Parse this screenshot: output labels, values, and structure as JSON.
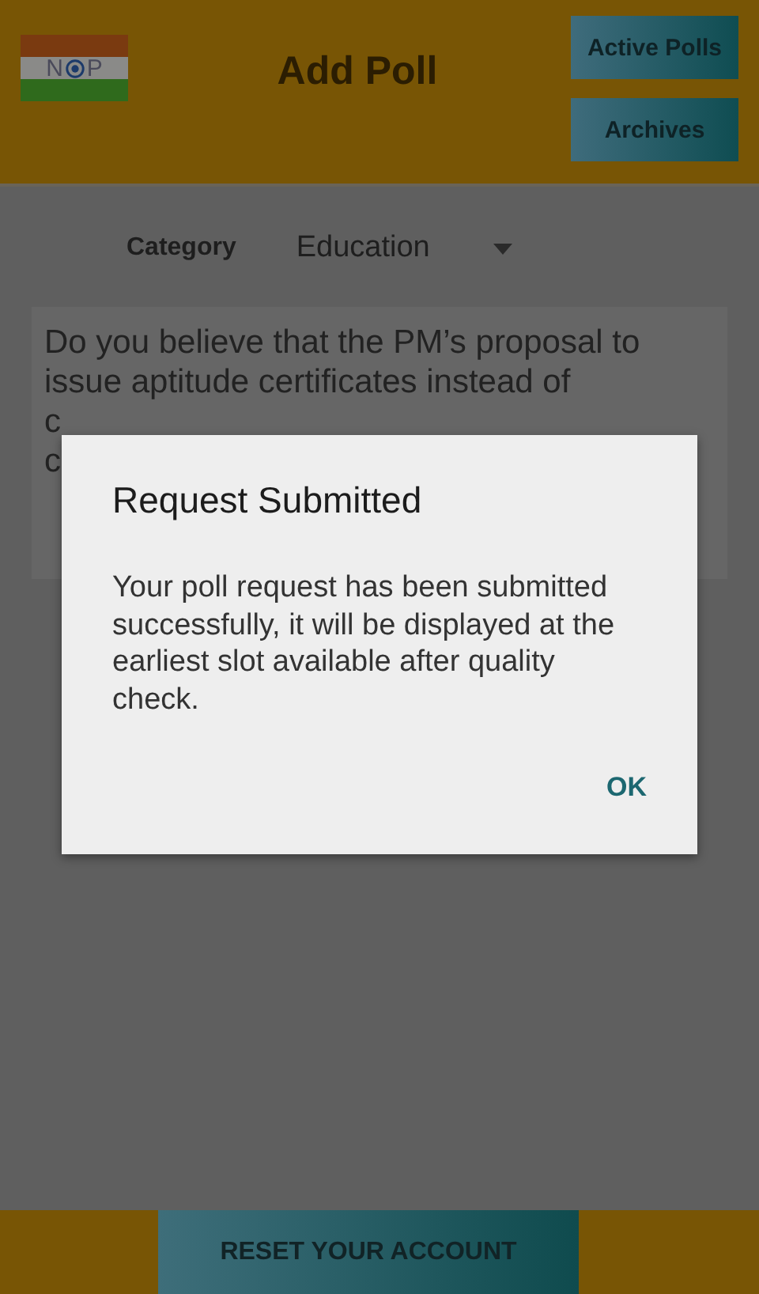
{
  "header": {
    "logo": {
      "left_letter": "N",
      "right_letter": "P"
    },
    "title": "Add Poll",
    "buttons": [
      "Active Polls",
      "Archives"
    ]
  },
  "category": {
    "label": "Category",
    "value": "Education"
  },
  "question_lines": [
    "Do you believe that the PM’s proposal to",
    "issue aptitude certificates instead of",
    "c",
    "c"
  ],
  "dialog": {
    "title": "Request Submitted",
    "message": "Your poll request has been submitted successfully, it will be displayed at the earliest slot available after quality check.",
    "button": "OK"
  },
  "footer": {
    "button": "RESET YOUR ACCOUNT"
  }
}
